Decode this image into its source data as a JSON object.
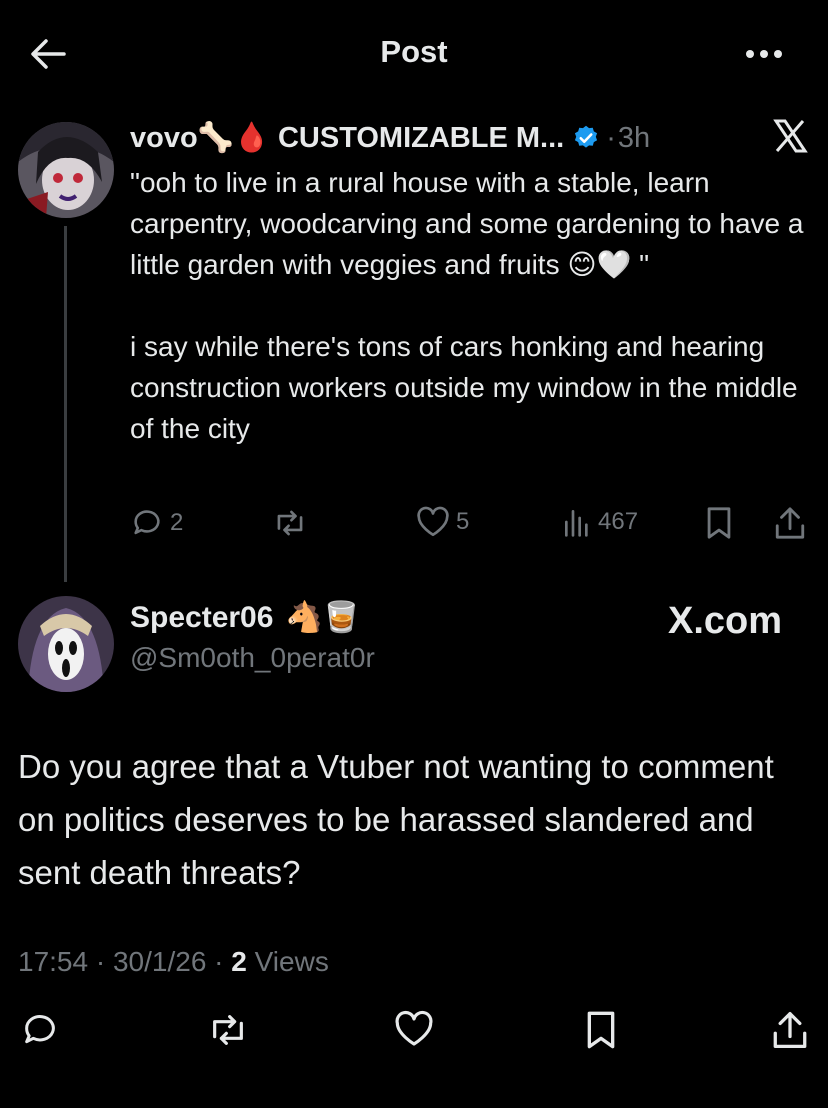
{
  "header": {
    "title": "Post"
  },
  "quoted_post": {
    "author_name": "vovo🦴🩸 CUSTOMIZABLE M...",
    "verified": true,
    "separator": "·",
    "time": "3h",
    "paragraph1": "\"ooh to live in a rural house with a stable, learn carpentry, woodcarving and some gardening to have a little garden with veggies and fruits 😊🤍 \"",
    "paragraph2": "i say while there's tons of cars honking and hearing construction workers outside my window in the middle of the city",
    "replies": "2",
    "likes": "5",
    "views": "467"
  },
  "main_post": {
    "author_name": "Specter06",
    "author_emojis": "🐴🥃",
    "handle": "@Sm0oth_0perat0r",
    "watermark": "X.com",
    "text": "Do you agree that a Vtuber not wanting to comment on politics deserves to be harassed slandered and sent death threats?",
    "time": "17:54",
    "date": "30/1/26",
    "dot1": " · ",
    "dot2": " · ",
    "views_count": "2",
    "views_label": " Views"
  },
  "colors": {
    "background": "#000000",
    "text": "#e7e9ea",
    "muted": "#71767b",
    "verified": "#1d9bf0",
    "thread_line": "#3a3d40"
  },
  "icons": [
    "back-arrow-icon",
    "more-dots-icon",
    "x-logo-icon",
    "verified-badge-icon",
    "reply-icon",
    "repost-icon",
    "like-icon",
    "views-icon",
    "bookmark-icon",
    "share-icon"
  ]
}
